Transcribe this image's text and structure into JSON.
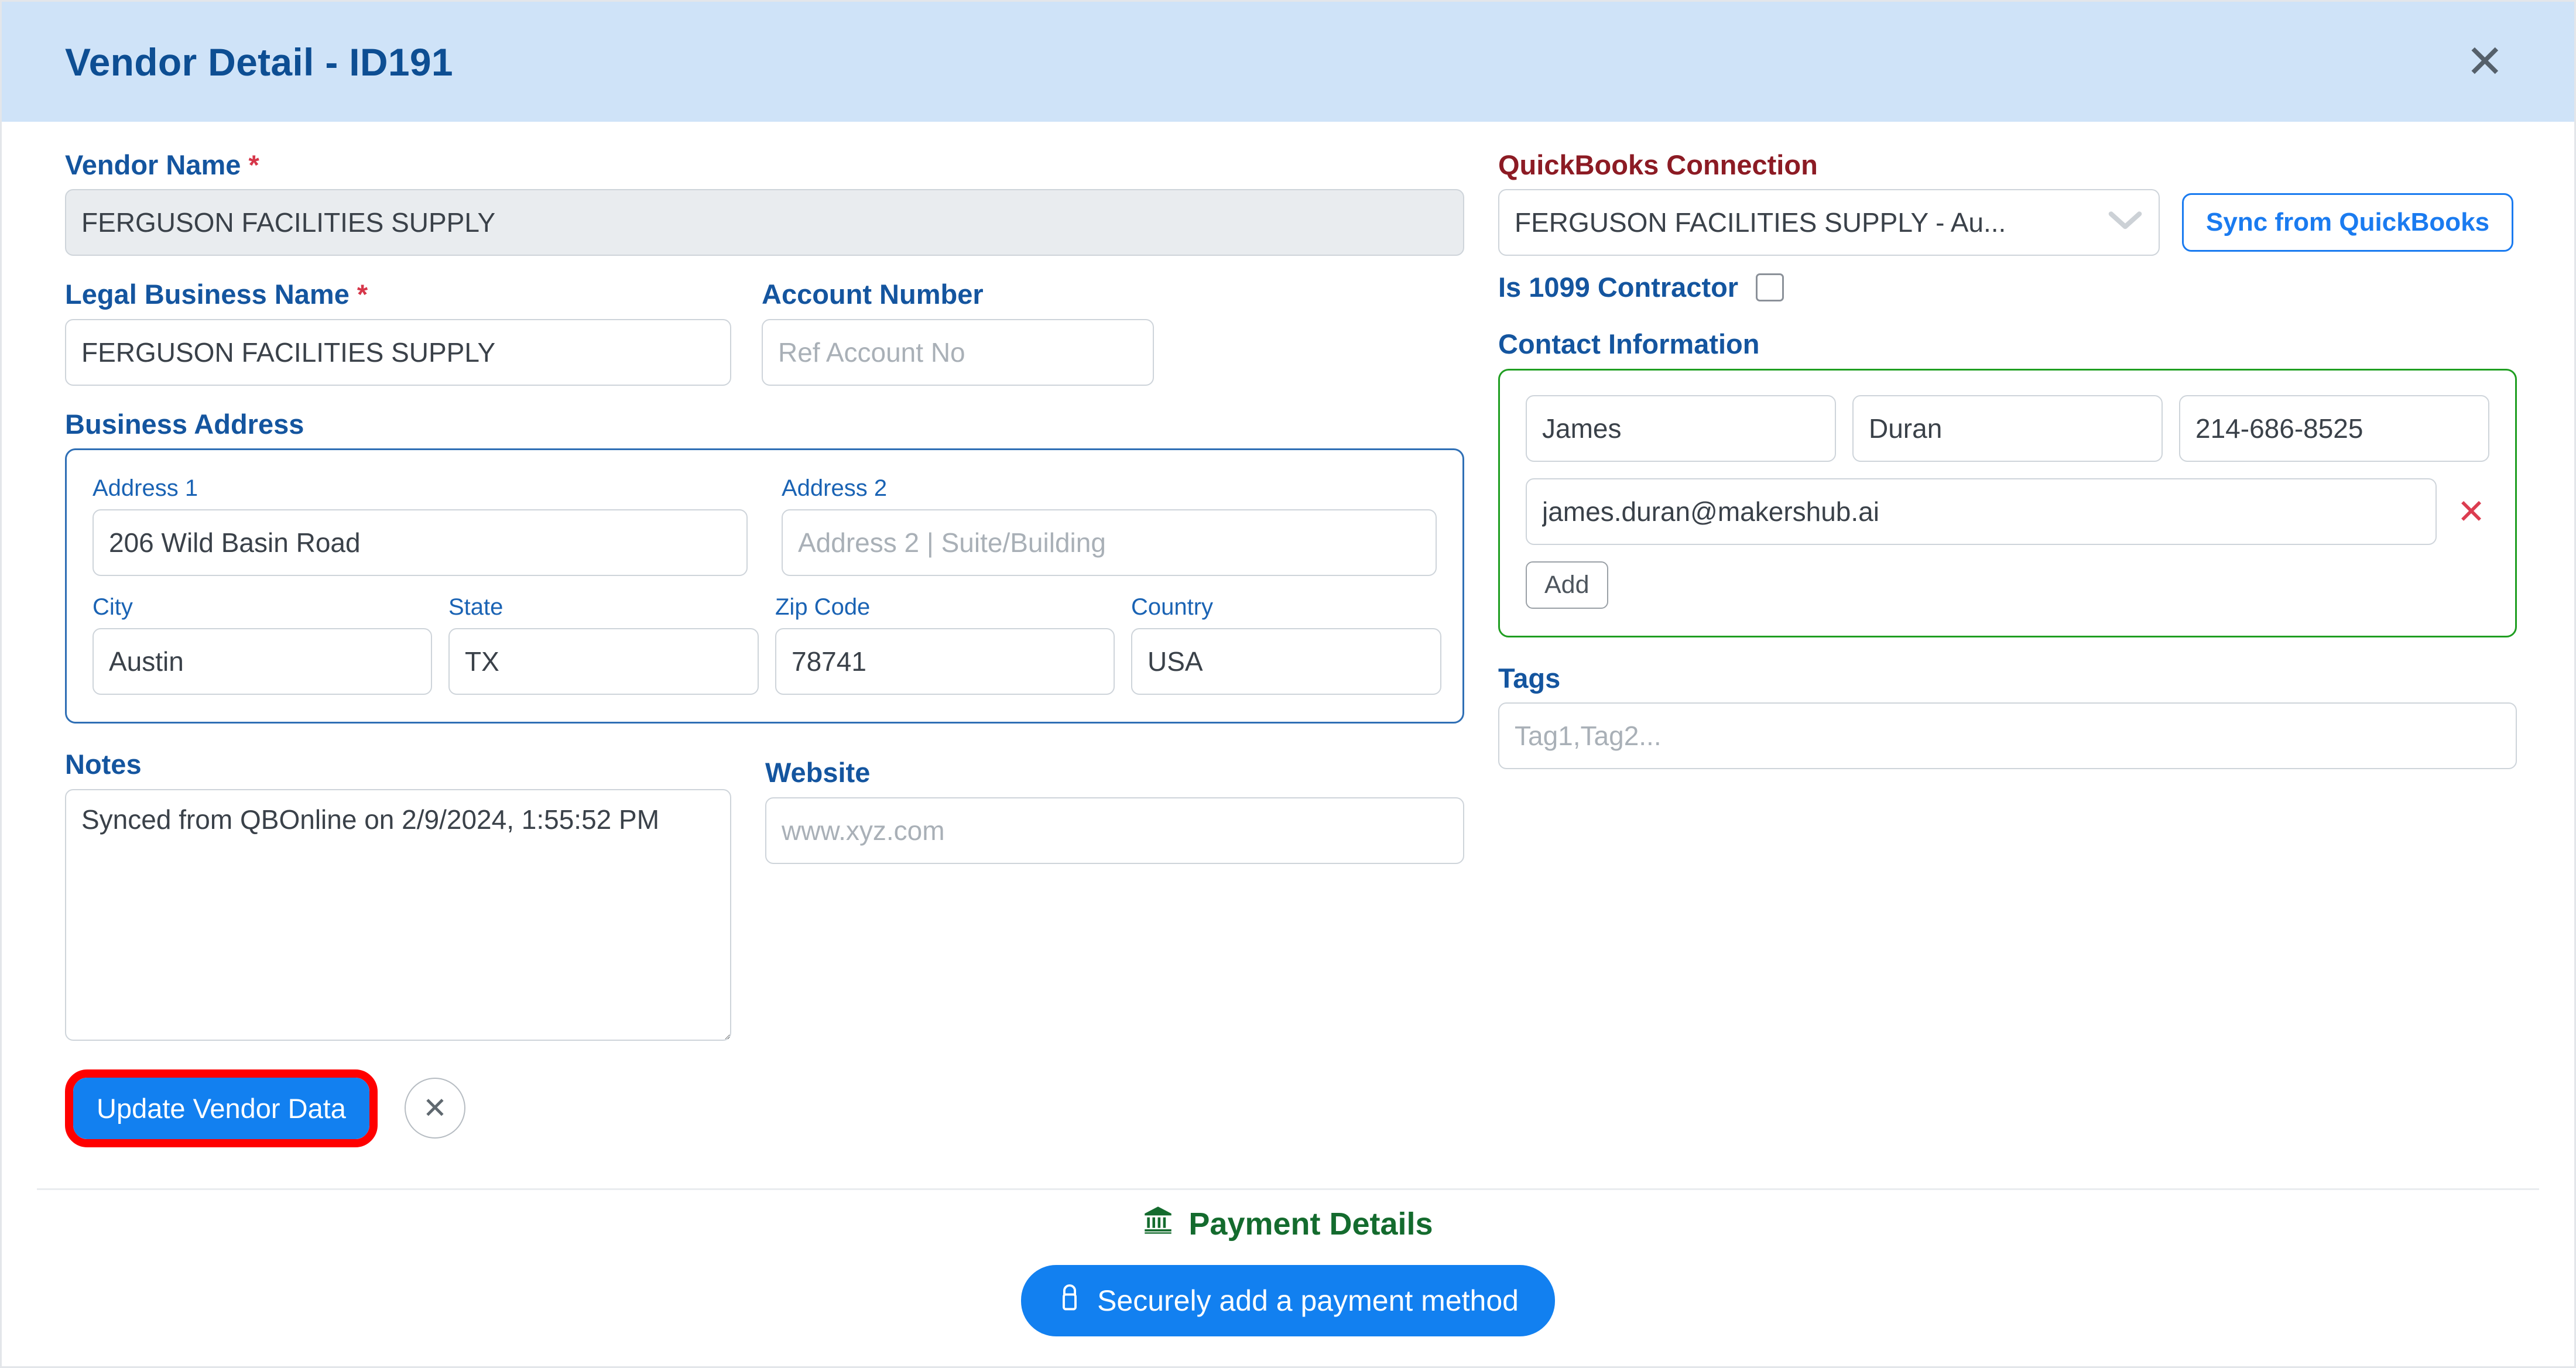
{
  "header": {
    "title": "Vendor Detail - ID191",
    "close_label": "✕"
  },
  "form": {
    "vendor_name": {
      "label": "Vendor Name",
      "required_mark": "*",
      "value": "FERGUSON FACILITIES SUPPLY"
    },
    "legal_business_name": {
      "label": "Legal Business Name",
      "required_mark": "*",
      "value": "FERGUSON FACILITIES SUPPLY"
    },
    "account_number": {
      "label": "Account Number",
      "value": "",
      "placeholder": "Ref Account No"
    },
    "business_address": {
      "label": "Business Address",
      "address1": {
        "label": "Address 1",
        "value": "206 Wild Basin Road",
        "placeholder": ""
      },
      "address2": {
        "label": "Address 2",
        "value": "",
        "placeholder": "Address 2 | Suite/Building"
      },
      "city": {
        "label": "City",
        "value": "Austin"
      },
      "state": {
        "label": "State",
        "value": "TX"
      },
      "zip": {
        "label": "Zip Code",
        "value": "78741"
      },
      "country": {
        "label": "Country",
        "value": "USA"
      }
    },
    "notes": {
      "label": "Notes",
      "value": "Synced from QBOnline on 2/9/2024, 1:55:52 PM"
    },
    "website": {
      "label": "Website",
      "value": "",
      "placeholder": "www.xyz.com"
    }
  },
  "quickbooks": {
    "label": "QuickBooks Connection",
    "selected_connection": "FERGUSON FACILITIES SUPPLY - Au...",
    "sync_button": "Sync from QuickBooks",
    "contractor_label": "Is 1099 Contractor",
    "contractor_checked": false
  },
  "contact": {
    "label": "Contact Information",
    "first_name": "James",
    "last_name": "Duran",
    "phone": "214-686-8525",
    "email": "james.duran@makershub.ai",
    "remove_label": "✕",
    "add_button": "Add"
  },
  "tags": {
    "label": "Tags",
    "value": "",
    "placeholder": "Tag1,Tag2..."
  },
  "actions": {
    "update_button": "Update Vendor Data",
    "cancel_button": "✕"
  },
  "payment": {
    "section_title": "Payment Details",
    "add_method_button": "Securely add a payment method"
  },
  "colors": {
    "header_bg": "#cfe3f8",
    "title_blue": "#0d4e93",
    "label_blue": "#14559f",
    "maroon": "#8c1b24",
    "primary_blue": "#1280f0",
    "green_border": "#1f9e21",
    "highlight_red": "#ff0000",
    "payment_green": "#146b2e"
  }
}
